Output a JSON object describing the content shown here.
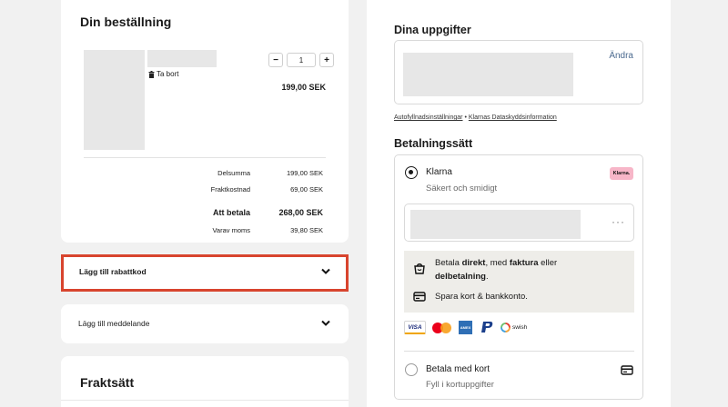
{
  "order": {
    "title": "Din beställning",
    "remove_label": "Ta bort",
    "quantity": "1",
    "minus": "−",
    "plus": "+",
    "item_price": "199,00 SEK",
    "subtotal_label": "Delsumma",
    "subtotal": "199,00 SEK",
    "shipping_label": "Fraktkostnad",
    "shipping": "69,00 SEK",
    "total_label": "Att betala",
    "total": "268,00 SEK",
    "vat_label": "Varav moms",
    "vat": "39,80 SEK"
  },
  "coupon": {
    "label": "Lägg till rabattkod"
  },
  "message": {
    "label": "Lägg till meddelande"
  },
  "shipping_method": {
    "title": "Fraktsätt"
  },
  "details": {
    "title": "Dina uppgifter",
    "edit_label": "Ändra",
    "autofill_link": "Autofyllnadsinställningar",
    "separator": "•",
    "privacy_link": "Klarnas Dataskyddsinformation"
  },
  "payment": {
    "title": "Betalningssätt",
    "klarna_name": "Klarna",
    "klarna_sub": "Säkert och smidigt",
    "klarna_badge": "Klarna.",
    "more": "···",
    "info_text_1": "Betala ",
    "info_bold_1": "direkt",
    "info_text_2": ", med ",
    "info_bold_2": "faktura",
    "info_text_3": " eller",
    "info_bold_3": "delbetalning",
    "info_text_4": ".",
    "info_save": "Spara kort & bankkonto.",
    "logo_visa": "VISA",
    "logo_amex": "AMEX",
    "logo_swish": "swish",
    "card_name": "Betala med kort",
    "card_sub": "Fyll i kortuppgifter"
  },
  "colors": {
    "highlight_border": "#d8442e",
    "klarna_pink": "#f7b6c8",
    "link_blue": "#4b6a8f",
    "page_bg": "#f1f1f1"
  },
  "icons": [
    "trash-icon",
    "chevron-down-icon",
    "more-dots-icon",
    "shopping-bag-icon",
    "credit-card-icon"
  ]
}
